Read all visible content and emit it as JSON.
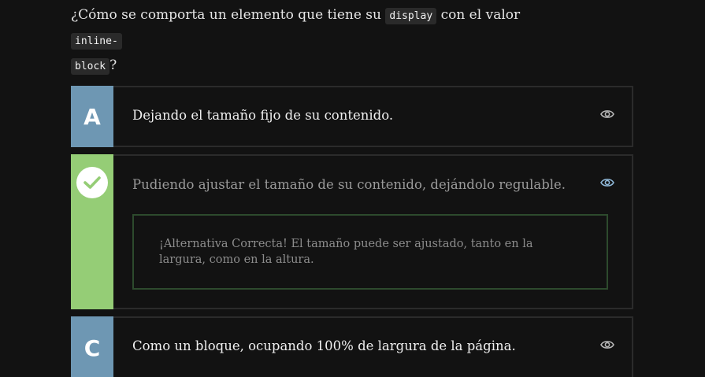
{
  "question": {
    "prefix": "¿Cómo se comporta un elemento que tiene su ",
    "code1": "display",
    "middle": " con el valor ",
    "code2a": "inline-",
    "code2b": "block",
    "suffix": "?"
  },
  "options": [
    {
      "letter": "A",
      "text": "Dejando el tamaño fijo de su contenido.",
      "icon": "eye-icon"
    },
    {
      "letter": "",
      "text": "Pudiendo ajustar el tamaño de su contenido, dejándolo regulable.",
      "icon": "check-icon",
      "feedback": "¡Alternativa Correcta! El tamaño puede ser ajustado, tanto en la largura, como en la altura."
    },
    {
      "letter": "C",
      "text": "Como un bloque, ocupando 100% de largura de la página.",
      "icon": "eye-icon"
    }
  ],
  "colors": {
    "background": "#121212",
    "letter_badge": "#6e97b3",
    "correct_badge": "#95cd76",
    "feedback_border": "#2d4a2d",
    "eye_active": "#8fb8d8"
  }
}
